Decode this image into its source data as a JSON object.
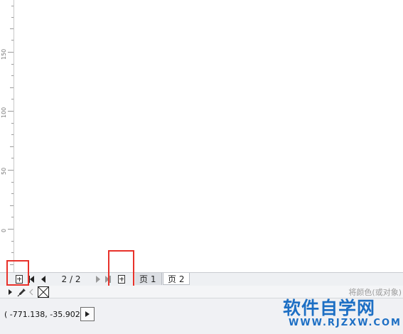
{
  "ruler": {
    "labels": [
      "150",
      "100",
      "50",
      "0"
    ]
  },
  "page_nav": {
    "counter": "2 / 2",
    "tabs": [
      {
        "label": "页 1",
        "active": false
      },
      {
        "label": "页 2",
        "active": true
      }
    ]
  },
  "color_bar": {
    "hint": "将颜色(或对象)"
  },
  "status": {
    "coordinates": "( -771.138, -35.902 )"
  },
  "watermark": {
    "title": "软件自学网",
    "url": "WWW.RJZXW.COM"
  },
  "colors": {
    "highlight": "#e8312a",
    "watermark": "#1d6fc4"
  }
}
